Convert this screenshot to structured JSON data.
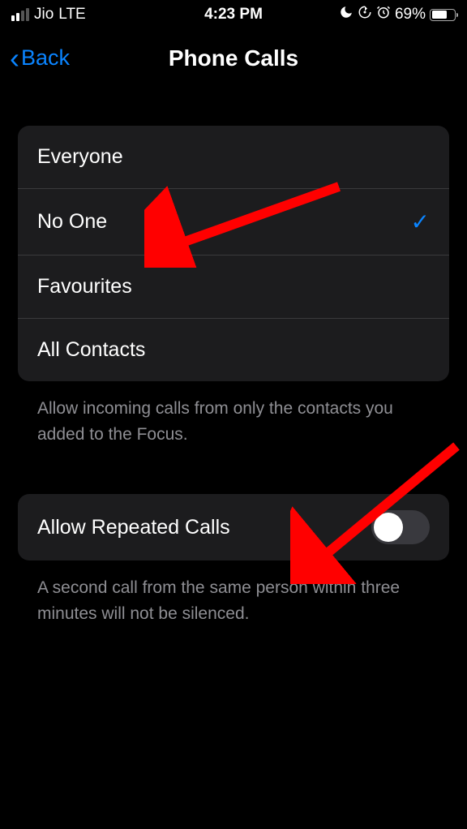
{
  "statusBar": {
    "carrier": "Jio",
    "network": "LTE",
    "time": "4:23 PM",
    "batteryPercent": "69%"
  },
  "header": {
    "backLabel": "Back",
    "title": "Phone Calls"
  },
  "allowFrom": {
    "options": [
      {
        "label": "Everyone",
        "selected": false
      },
      {
        "label": "No One",
        "selected": true
      },
      {
        "label": "Favourites",
        "selected": false
      },
      {
        "label": "All Contacts",
        "selected": false
      }
    ],
    "footer": "Allow incoming calls from only the contacts you added to the Focus."
  },
  "repeatedCalls": {
    "label": "Allow Repeated Calls",
    "enabled": false,
    "footer": "A second call from the same person within three minutes will not be silenced."
  }
}
